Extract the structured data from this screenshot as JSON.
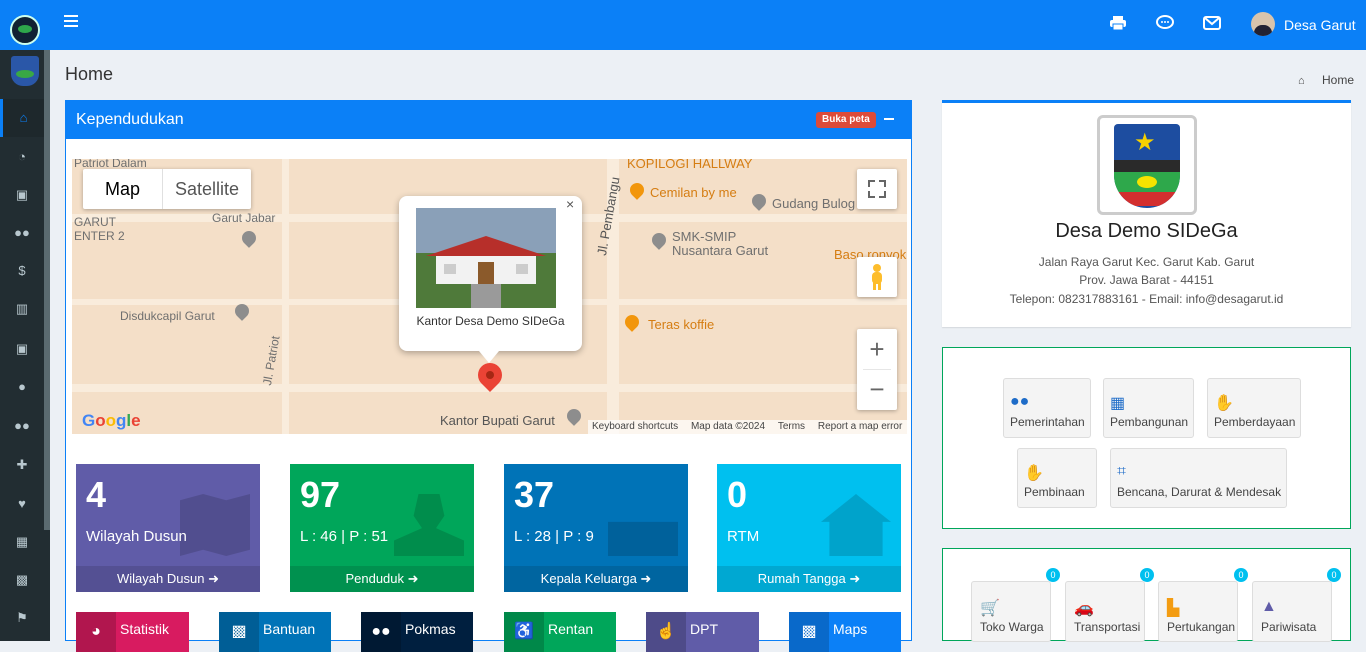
{
  "header": {
    "user_name": "Desa Garut"
  },
  "page": {
    "title": "Home",
    "breadcrumb": "Home"
  },
  "kependudukan": {
    "title": "Kependudukan",
    "buka_peta": "Buka peta",
    "map": {
      "type_map": "Map",
      "type_satellite": "Satellite",
      "info_caption": "Kantor Desa Demo SIDeGa",
      "google": "Google",
      "attribution": [
        "Keyboard shortcuts",
        "Map data ©2024",
        "Terms",
        "Report a map error"
      ],
      "labels": {
        "patriot_dalam": "Patriot Dalam",
        "garut": "GARUT",
        "center2": "ENTER 2",
        "sekjabar": "Garut Jabar",
        "disdukcapil": "Disdukcapil Garut",
        "jl_patriot": "Jl. Patriot",
        "jl_pembangunan": "Jl. Pembangu",
        "kopilogi": "KOPILOGI HALLWAY",
        "cemilan": "Cemilan by me",
        "gudang": "Gudang Bulog",
        "smk": "SMK-SMIP",
        "nusantara": "Nusantara Garut",
        "baso": "Baso ronyok",
        "teras": "Teras koffie",
        "bupati": "Kantor Bupati Garut"
      }
    },
    "stats": [
      {
        "num": "4",
        "sub": "Wilayah Dusun",
        "foot": "Wilayah Dusun",
        "color": "#605ca8"
      },
      {
        "num": "97",
        "sub": "L : 46 | P : 51",
        "foot": "Penduduk",
        "color": "#00a65a"
      },
      {
        "num": "37",
        "sub": "L : 28 | P : 9",
        "foot": "Kepala Keluarga",
        "color": "#0073b7"
      },
      {
        "num": "0",
        "sub": "RTM",
        "foot": "Rumah Tangga",
        "color": "#00c0ef"
      }
    ],
    "quick": [
      {
        "label": "Statistik",
        "color": "#d81b60"
      },
      {
        "label": "Bantuan",
        "color": "#0073b7"
      },
      {
        "label": "Pokmas",
        "color": "#001f3f"
      },
      {
        "label": "Rentan",
        "color": "#00a65a"
      },
      {
        "label": "DPT",
        "color": "#605ca8"
      },
      {
        "label": "Maps",
        "color": "#0b80f7"
      }
    ]
  },
  "profile": {
    "name": "Desa Demo SIDeGa",
    "address": "Jalan Raya Garut Kec. Garut Kab. Garut",
    "province": "Prov. Jawa Barat - 44151",
    "contact": "Telepon: 082317883161 - Email: info@desagarut.id"
  },
  "menu": {
    "pemerintahan": "Pemerintahan",
    "pembangunan": "Pembangunan",
    "pemberdayaan": "Pemberdayaan",
    "pembinaan": "Pembinaan",
    "bencana": "Bencana, Darurat & Mendesak"
  },
  "shop": [
    {
      "label": "Toko Warga",
      "badge": "0"
    },
    {
      "label": "Transportasi",
      "badge": "0"
    },
    {
      "label": "Pertukangan",
      "badge": "0"
    },
    {
      "label": "Pariwisata",
      "badge": "0"
    }
  ]
}
